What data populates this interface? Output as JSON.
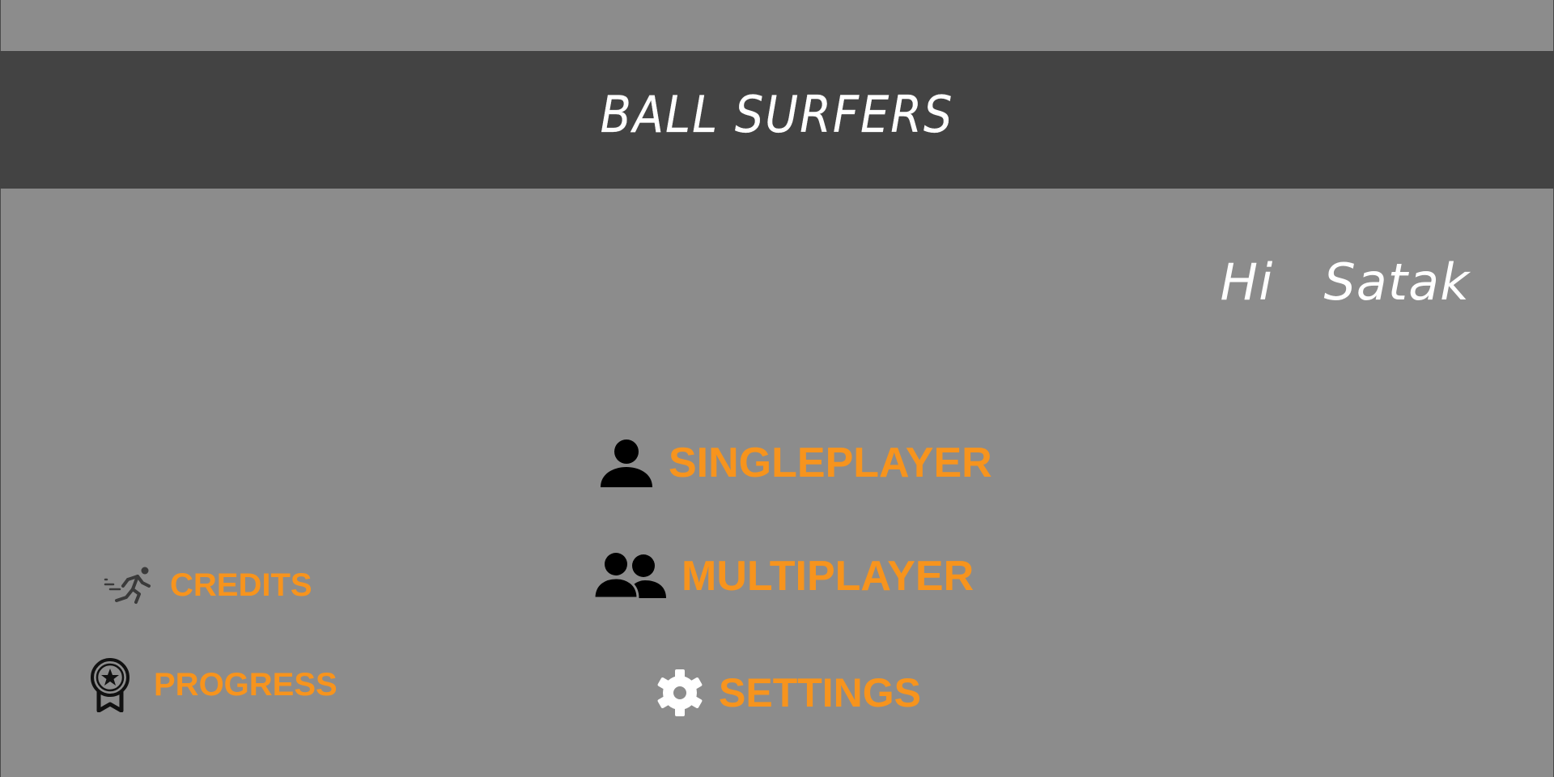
{
  "header": {
    "title": "BALL SURFERS"
  },
  "greeting": {
    "text": "Hi   Satak"
  },
  "menu": {
    "singleplayer": {
      "label": "SINGLEPLAYER",
      "icon": "person-icon"
    },
    "multiplayer": {
      "label": "MULTIPLAYER",
      "icon": "people-icon"
    },
    "settings": {
      "label": "SETTINGS",
      "icon": "gear-icon"
    }
  },
  "side_menu": {
    "credits": {
      "label": "CREDITS",
      "icon": "running-person-icon"
    },
    "progress": {
      "label": "PROGRESS",
      "icon": "award-badge-icon"
    }
  },
  "colors": {
    "background": "#8c8c8c",
    "header_bar": "#434343",
    "accent": "#f7941d",
    "title_text": "#ffffff"
  }
}
